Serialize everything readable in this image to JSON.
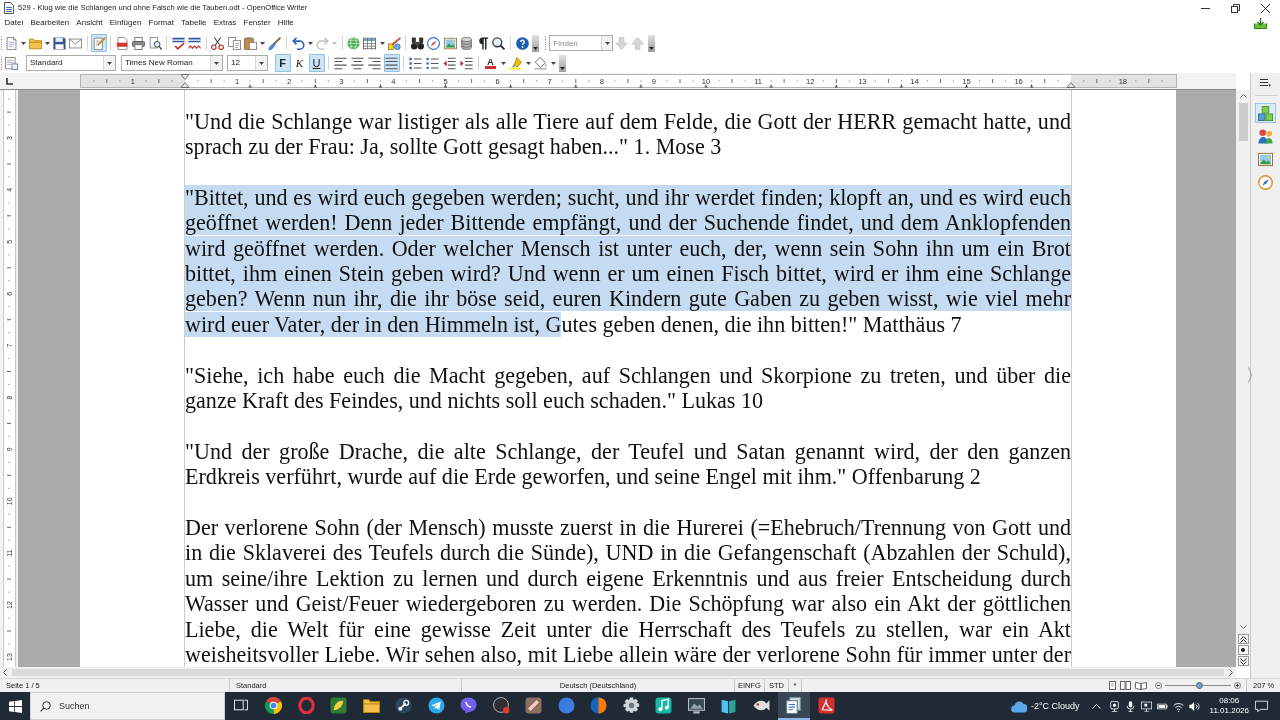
{
  "window": {
    "title": "529 - Klug wie die Schlangen und ohne Falsch wie die Tauben.odt - OpenOffice Writer"
  },
  "menu": [
    "Datei",
    "Bearbeiten",
    "Ansicht",
    "Einfügen",
    "Format",
    "Tabelle",
    "Extras",
    "Fenster",
    "Hilfe"
  ],
  "standard_toolbar": {
    "edit_mode": true,
    "redo_disabled": true
  },
  "find_toolbar": {
    "placeholder": "Finden",
    "arrows_disabled": true
  },
  "formatting_toolbar": {
    "paragraph_style": "Standard",
    "font_name": "Times New Roman",
    "font_size": "12",
    "style_buttons": [
      {
        "label": "F",
        "pressed": true
      },
      {
        "label": "K",
        "pressed": false
      },
      {
        "label": "U",
        "pressed": true
      }
    ],
    "alignment_buttons": [
      {
        "selected": false
      },
      {
        "selected": false
      },
      {
        "selected": false
      },
      {
        "selected": true
      }
    ],
    "font_color_label": "A"
  },
  "ruler": {
    "labels": [
      "1",
      "1",
      "2",
      "3",
      "4",
      "5",
      "6",
      "7",
      "8",
      "9",
      "10",
      "11",
      "12",
      "13",
      "14",
      "15",
      "16",
      "18"
    ]
  },
  "vertical_ruler": {
    "labels": [
      "3",
      "4",
      "5",
      "6",
      "7",
      "8",
      "9",
      "10",
      "11",
      "12",
      "13"
    ]
  },
  "document": {
    "paragraphs": [
      {
        "segments": [
          {
            "text": "\"Und die Schlange war listiger als alle Tiere auf dem Felde, die Gott der HERR gemacht hatte, und sprach zu der Frau: Ja, sollte Gott gesagt haben...\" 1. Mose 3",
            "selected": false
          }
        ]
      },
      {
        "segments": [
          {
            "text": "\"Bittet, und es wird euch gegeben werden; sucht, und ihr werdet finden; klopft an, und es wird euch geöffnet werden!  Denn jeder Bittende empfängt, und der Suchende findet, und dem Anklopfenden wird geöffnet werden.  Oder welcher Mensch ist unter euch, der, wenn sein Sohn ihn um ein Brot bittet, ihm einen Stein geben wird?  Und wenn er um einen Fisch bittet, wird er ihm eine Schlange geben?  Wenn nun ihr, die ihr böse seid, euren Kindern gute Gaben zu geben wisst, wie viel mehr wird euer Vater, der in den Himmeln ist, G",
            "selected": true
          },
          {
            "text": "utes geben denen, die ihn bitten!\" Matthäus 7",
            "selected": false
          }
        ]
      },
      {
        "segments": [
          {
            "text": "\"Siehe, ich habe euch die Macht gegeben, auf Schlangen und Skorpione zu treten, und über die ganze Kraft des Feindes, und nichts soll euch schaden.\" Lukas 10",
            "selected": false
          }
        ]
      },
      {
        "segments": [
          {
            "text": "\"Und der große Drache, die alte Schlange, der Teufel und Satan genannt wird, der den ganzen Erdkreis verführt, wurde auf die Erde geworfen, und seine Engel mit ihm.\" Offenbarung 2",
            "selected": false
          }
        ]
      },
      {
        "segments": [
          {
            "text": "Der verlorene Sohn (der Mensch) musste zuerst in die Hurerei (=Ehebruch/Trennung von Gott und in die Sklaverei des Teufels durch die Sünde), UND in die Gefangenschaft (Abzahlen der Schuld), um seine/ihre Lektion zu lernen und durch eigene Erkenntnis und aus freier Entscheidung durch Wasser und Geist/Feuer wiedergeboren zu werden. Die Schöpfung war also ein Akt der göttlichen Liebe, die Welt für eine gewisse Zeit unter die Herrschaft des Teufels zu stellen, war ein Akt weisheitsvoller Liebe. Wir sehen also, mit Liebe allein wäre der verlorene Sohn für immer unter der",
            "selected": false
          }
        ]
      }
    ]
  },
  "sidebar": {
    "tabs": [
      {
        "selected": true
      },
      {
        "selected": false
      },
      {
        "selected": false
      },
      {
        "selected": false
      }
    ]
  },
  "status_bar": {
    "page": "Seite 1 / 5",
    "page_style": "Standard",
    "language": "Deutsch (Deutschland)",
    "insert_mode": "EINFG",
    "selection_mode": "STD",
    "modified": "*",
    "zoom_slider": {
      "level": 0.53
    },
    "zoom": "207 %"
  },
  "taskbar": {
    "search_placeholder": "Suchen",
    "apps": [
      {
        "active": false
      },
      {
        "active": false
      },
      {
        "active": false
      },
      {
        "active": false
      },
      {
        "active": false
      },
      {
        "active": false
      },
      {
        "active": false
      },
      {
        "active": false
      },
      {
        "active": false
      },
      {
        "active": false
      },
      {
        "active": false
      },
      {
        "active": false
      },
      {
        "active": false
      },
      {
        "active": false
      },
      {
        "active": false
      },
      {
        "active": false
      },
      {
        "active": true
      },
      {
        "active": false
      }
    ],
    "weather": "-2°C Cloudy",
    "time": "08:06",
    "date": "11.01.2026"
  }
}
